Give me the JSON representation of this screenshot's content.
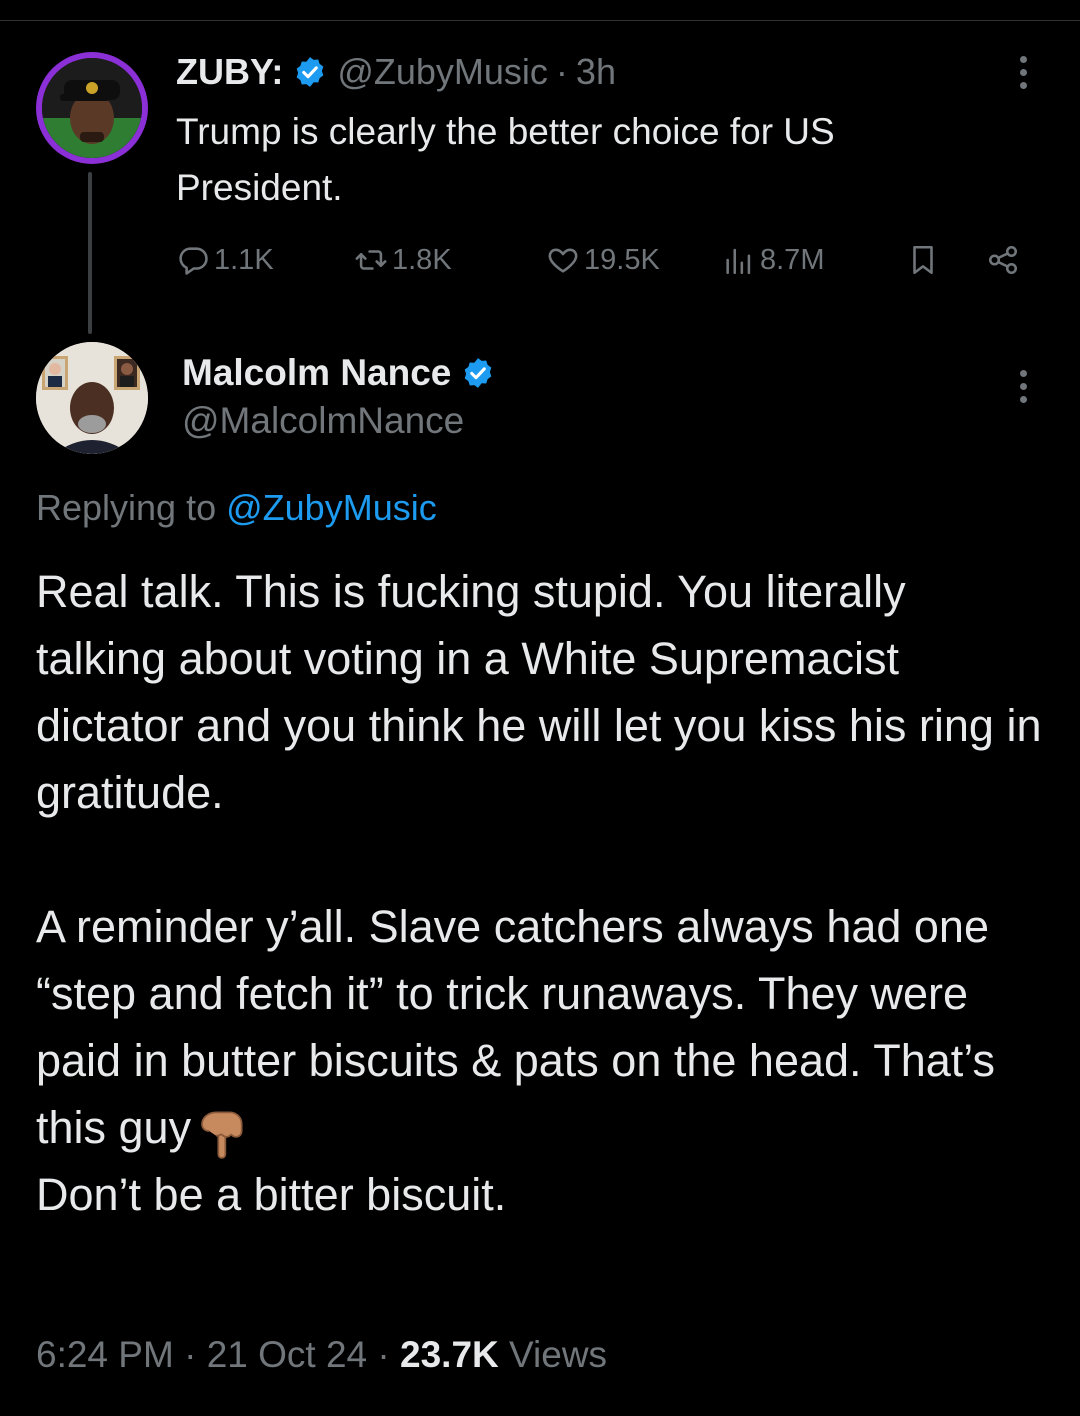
{
  "parent_tweet": {
    "display_name": "ZUBY:",
    "handle": "@ZubyMusic",
    "separator": "·",
    "time": "3h",
    "text_line1": "Trump is clearly the better choice for US",
    "text_line2": "President.",
    "metrics": {
      "replies": "1.1K",
      "reposts": "1.8K",
      "likes": "19.5K",
      "views": "8.7M"
    },
    "icons": [
      "reply-icon",
      "repost-icon",
      "like-icon",
      "views-icon",
      "bookmark-icon",
      "share-icon",
      "more-icon",
      "verified-badge-icon"
    ]
  },
  "reply_tweet": {
    "display_name": "Malcolm Nance",
    "handle": "@MalcolmNance",
    "replying_prefix": "Replying to",
    "replying_to": "@ZubyMusic",
    "body_paragraph1": "Real talk. This is fucking stupid. You literally talking about voting in a White Supremacist dictator and you think he will let you kiss his ring in gratitude.",
    "body_paragraph2_line1": "A reminder y’all.  Slave catchers always had one “step and fetch it” to trick runaways.  They were paid in butter biscuits & pats on the head.  That’s this guy",
    "body_paragraph2_line2": "Don’t be a bitter biscuit.",
    "timestamp": "6:24 PM",
    "separator": "·",
    "date": "21 Oct 24",
    "views_count": "23.7K",
    "views_label": "Views"
  },
  "colors": {
    "background": "#000000",
    "text_primary": "#e7e9ea",
    "text_secondary": "#71767b",
    "link": "#1d9bf0",
    "verified": "#1d9bf0",
    "avatar_ring": "#8b2fd6"
  }
}
